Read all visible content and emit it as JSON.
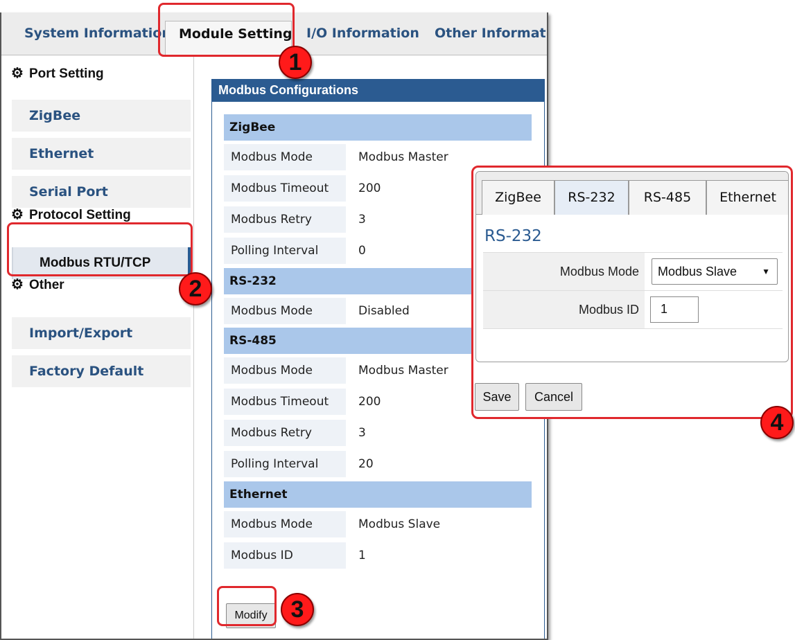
{
  "top_tabs": [
    {
      "label": "System Information"
    },
    {
      "label": "Module Setting"
    },
    {
      "label": "I/O Information"
    },
    {
      "label": "Other Information"
    }
  ],
  "sidebar": {
    "port_setting": {
      "title": "Port Setting",
      "items": [
        {
          "label": "ZigBee"
        },
        {
          "label": "Ethernet"
        },
        {
          "label": "Serial Port"
        }
      ]
    },
    "protocol_setting": {
      "title": "Protocol Setting",
      "items": [
        {
          "label": "Modbus RTU/TCP"
        }
      ]
    },
    "other": {
      "title": "Other",
      "items": [
        {
          "label": "Import/Export"
        },
        {
          "label": "Factory Default"
        }
      ]
    }
  },
  "config": {
    "title": "Modbus Configurations",
    "zigbee": {
      "title": "ZigBee",
      "rows": [
        {
          "label": "Modbus Mode",
          "value": "Modbus Master"
        },
        {
          "label": "Modbus Timeout",
          "value": "200"
        },
        {
          "label": "Modbus Retry",
          "value": "3"
        },
        {
          "label": "Polling Interval",
          "value": "0"
        }
      ]
    },
    "rs232": {
      "title": "RS-232",
      "rows": [
        {
          "label": "Modbus Mode",
          "value": "Disabled"
        }
      ]
    },
    "rs485": {
      "title": "RS-485",
      "rows": [
        {
          "label": "Modbus Mode",
          "value": "Modbus Master"
        },
        {
          "label": "Modbus Timeout",
          "value": "200"
        },
        {
          "label": "Modbus Retry",
          "value": "3"
        },
        {
          "label": "Polling Interval",
          "value": "20"
        }
      ]
    },
    "ethernet": {
      "title": "Ethernet",
      "rows": [
        {
          "label": "Modbus Mode",
          "value": "Modbus Slave"
        },
        {
          "label": "Modbus ID",
          "value": "1"
        }
      ]
    },
    "modify_label": "Modify"
  },
  "popup": {
    "tabs": [
      {
        "label": "ZigBee"
      },
      {
        "label": "RS-232"
      },
      {
        "label": "RS-485"
      },
      {
        "label": "Ethernet"
      }
    ],
    "title": "RS-232",
    "mode_label": "Modbus Mode",
    "mode_value": "Modbus Slave",
    "id_label": "Modbus ID",
    "id_value": "1",
    "save_label": "Save",
    "cancel_label": "Cancel"
  },
  "steps": [
    "1",
    "2",
    "3",
    "4"
  ],
  "colors": {
    "accent": "#2b5b91",
    "callout": "#e0282d",
    "group_bar": "#aac7ea"
  }
}
